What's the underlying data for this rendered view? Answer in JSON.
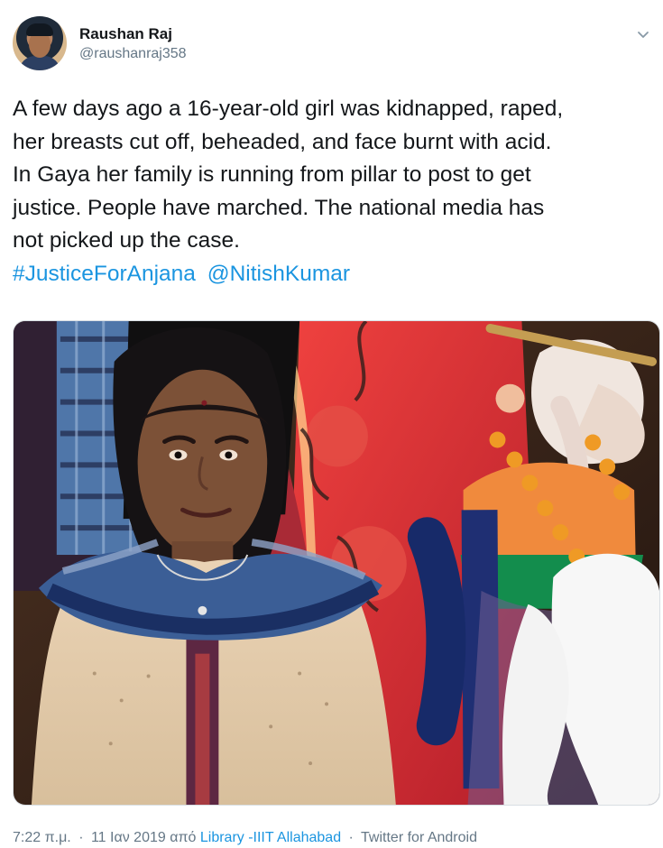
{
  "tweet": {
    "author_name": "Raushan Raj",
    "author_handle": "@raushanraj358",
    "text": "A few days ago a 16-year-old girl was kidnapped, raped,\nher breasts cut off, beheaded, and face burnt with acid.\nIn Gaya her family is running from pillar to post to get\njustice. People have marched. The national media has\nnot picked up the case.",
    "hashtag": "#JusticeForAnjana",
    "mention": "@NitishKumar",
    "time": "7:22 π.μ.",
    "date": "11 Ιαν 2019",
    "from_word": "από",
    "location": "Library -IIIT Allahabad",
    "source": "Twitter for Android"
  },
  "colors": {
    "link": "#1b95e0",
    "secondary_text": "#657786",
    "primary_text": "#14171a"
  },
  "icons": {
    "menu": "chevron-down-icon"
  }
}
